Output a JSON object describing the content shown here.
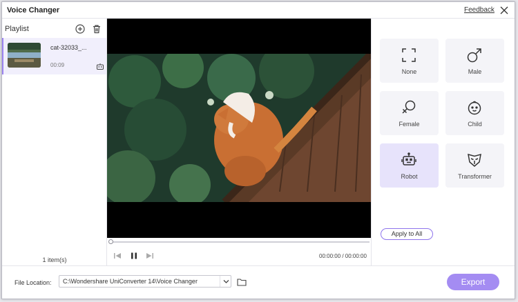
{
  "window": {
    "title": "Voice Changer",
    "feedback": "Feedback"
  },
  "playlist": {
    "label": "Playlist",
    "items": [
      {
        "name": "cat-32033_...",
        "duration": "00:09"
      }
    ],
    "count": "1 item(s)"
  },
  "player": {
    "progress": 0,
    "time": "00:00:00 / 00:00:00"
  },
  "effects": {
    "items": [
      {
        "label": "None",
        "icon": "none-frame-icon"
      },
      {
        "label": "Male",
        "icon": "male-symbol-icon"
      },
      {
        "label": "Female",
        "icon": "female-symbol-icon"
      },
      {
        "label": "Child",
        "icon": "child-face-icon"
      },
      {
        "label": "Robot",
        "icon": "robot-icon"
      },
      {
        "label": "Transformer",
        "icon": "transformer-mask-icon"
      }
    ],
    "selected": "Robot",
    "apply_all": "Apply to All"
  },
  "footer": {
    "location_label": "File Location:",
    "location_value": "C:\\Wondershare UniConverter 14\\Voice Changer",
    "export": "Export"
  },
  "colors": {
    "accent": "#a48cf2",
    "selected_bg": "#e7e3fb",
    "panel_bg": "#f4f4f8"
  }
}
